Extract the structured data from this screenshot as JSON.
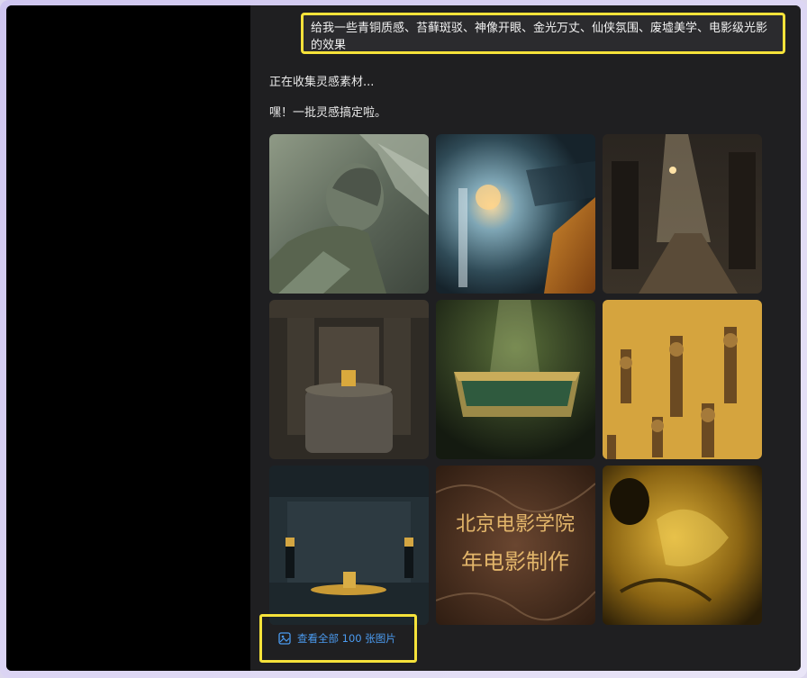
{
  "chat": {
    "user_message": "给我一些青铜质感、苔藓斑驳、神像开眼、金光万丈、仙侠氛围、废墟美学、电影级光影的效果",
    "status_collecting": "正在收集灵感素材...",
    "status_done": "嘿！一批灵感搞定啦。",
    "gallery": [
      {
        "icon": "bronze-statue-image"
      },
      {
        "icon": "light-portal-image"
      },
      {
        "icon": "ruins-corridor-image"
      },
      {
        "icon": "temple-altar-image"
      },
      {
        "icon": "jade-basin-image"
      },
      {
        "icon": "golden-pillars-image"
      },
      {
        "icon": "bronze-hall-image"
      },
      {
        "icon": "calligraphy-soil-image",
        "text_line_1": "北京电影学院",
        "text_line_2": "年电影制作"
      },
      {
        "icon": "golden-smoke-image"
      }
    ],
    "view_all_label": "查看全部 100 张图片"
  },
  "colors": {
    "highlight_border": "#f5e23a",
    "link": "#4b9bf0",
    "chat_background": "#1f1f21",
    "sidebar_background": "#000000"
  }
}
